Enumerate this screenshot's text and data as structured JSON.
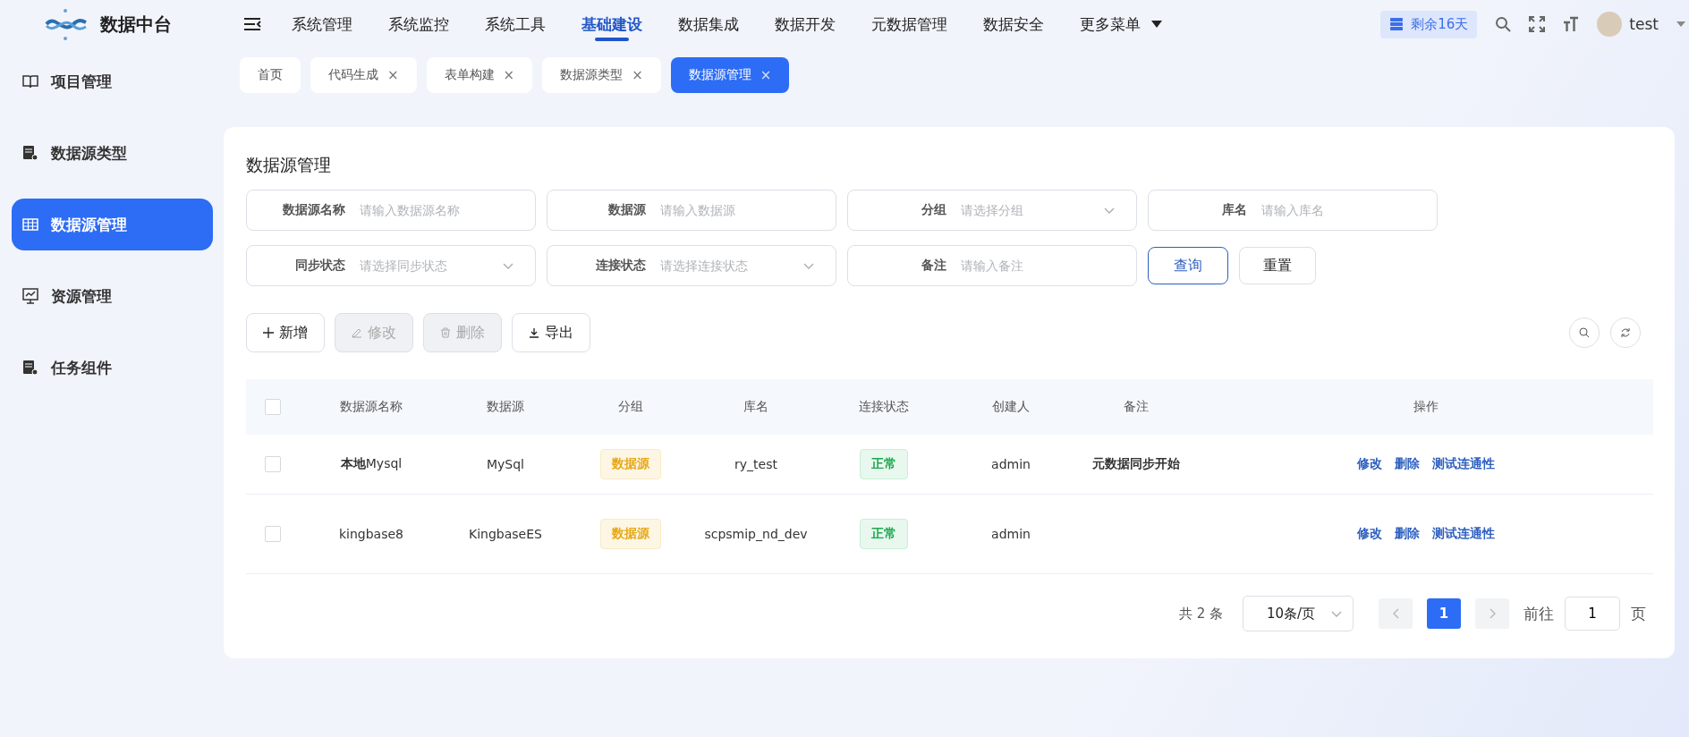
{
  "brand": {
    "name": "数据中台"
  },
  "nav": [
    {
      "label": "系统管理",
      "selected": false
    },
    {
      "label": "系统监控",
      "selected": false
    },
    {
      "label": "系统工具",
      "selected": false
    },
    {
      "label": "基础建设",
      "selected": true
    },
    {
      "label": "数据集成",
      "selected": false
    },
    {
      "label": "数据开发",
      "selected": false
    },
    {
      "label": "元数据管理",
      "selected": false
    },
    {
      "label": "数据安全",
      "selected": false
    }
  ],
  "more_menu": "更多菜单",
  "license_badge": "剩余16天",
  "user": "test",
  "sidebar": [
    {
      "label": "项目管理",
      "selected": false
    },
    {
      "label": "数据源类型",
      "selected": false
    },
    {
      "label": "数据源管理",
      "selected": true
    },
    {
      "label": "资源管理",
      "selected": false
    },
    {
      "label": "任务组件",
      "selected": false
    }
  ],
  "tabs": [
    {
      "label": "首页",
      "selected": false
    },
    {
      "label": "代码生成",
      "close": "×",
      "selected": false
    },
    {
      "label": "表单构建",
      "close": "×",
      "selected": false
    },
    {
      "label": "数据源类型",
      "close": "×",
      "selected": false
    },
    {
      "label": "数据源管理",
      "close": "×",
      "selected": true
    }
  ],
  "page_title": "数据源管理",
  "filters": [
    {
      "label": "数据源名称",
      "placeholder": "请输入数据源名称",
      "kind": "input"
    },
    {
      "label": "数据源",
      "placeholder": "请输入数据源",
      "kind": "input"
    },
    {
      "label": "分组",
      "placeholder": "请选择分组",
      "kind": "select"
    },
    {
      "label": "库名",
      "placeholder": "请输入库名",
      "kind": "input"
    },
    {
      "label": "同步状态",
      "placeholder": "请选择同步状态",
      "kind": "select"
    },
    {
      "label": "连接状态",
      "placeholder": "请选择连接状态",
      "kind": "select"
    },
    {
      "label": "备注",
      "placeholder": "请输入备注",
      "kind": "input"
    }
  ],
  "search_button": "查询",
  "reset_button": "重置",
  "toolbar": [
    {
      "label": "新增",
      "disabled": false
    },
    {
      "label": "修改",
      "disabled": true
    },
    {
      "label": "删除",
      "disabled": true
    },
    {
      "label": "导出",
      "disabled": false
    }
  ],
  "table": {
    "select_all_checked": false,
    "columns": [
      "数据源名称",
      "数据源",
      "分组",
      "库名",
      "连接状态",
      "创建人",
      "备注",
      "操作"
    ],
    "rows": [
      {
        "checked": false,
        "name": "**本地**Mysql",
        "datasource": "MySql",
        "group": "数据源",
        "database": "ry_test",
        "status": "正常",
        "creator": "admin",
        "remark": "元数据同步开始",
        "actions": [
          "修改",
          "删除",
          "测试连通性"
        ]
      },
      {
        "checked": false,
        "name": "kingbase8",
        "datasource": "KingbaseES",
        "group": "数据源",
        "database": "scpsmip_nd_dev",
        "status": "正常",
        "creator": "admin",
        "remark": "",
        "actions": [
          "修改",
          "删除",
          "测试连通性"
        ]
      }
    ]
  },
  "pagination": {
    "total": "共 2 条",
    "page_size": "10条/页",
    "pages": [
      {
        "label": "1",
        "selected": true
      }
    ],
    "goto_label": "前往",
    "goto_value": "1",
    "page_unit": "页"
  }
}
